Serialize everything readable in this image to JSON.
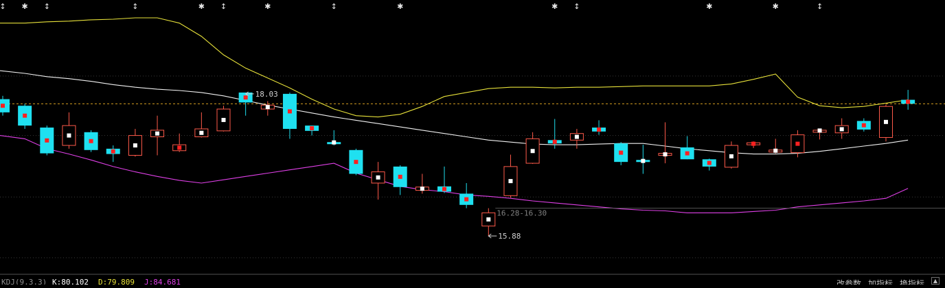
{
  "colors": {
    "background": "#000000",
    "grid": "#3a3a3a",
    "up_candle": "#ff5a4a",
    "down_candle": "#1fe0f0",
    "upper_band": "#e8e23a",
    "middle_band": "#f2f2f2",
    "lower_band": "#e040e8",
    "reference_line": "#d8a020",
    "annotation_text": "#d0d0d0",
    "marker_red": "#ff2020",
    "marker_white": "#ffffff",
    "event_marker": "#e8e8e8",
    "value_k": "#ffffff",
    "value_d": "#e8e23a",
    "value_j": "#e040e8",
    "menu_text": "#c0c0c0"
  },
  "chart_data": {
    "type": "candlestick",
    "ylim": [
      15.3,
      19.45
    ],
    "grid_values": [
      18.3,
      17.4,
      16.47,
      15.55
    ],
    "reference_price": 17.88,
    "event_markers": [
      {
        "index": 0,
        "symbol": "↕"
      },
      {
        "index": 1,
        "symbol": "✱"
      },
      {
        "index": 2,
        "symbol": "↕"
      },
      {
        "index": 6,
        "symbol": "↕"
      },
      {
        "index": 9,
        "symbol": "✱"
      },
      {
        "index": 10,
        "symbol": "↕"
      },
      {
        "index": 12,
        "symbol": "✱"
      },
      {
        "index": 15,
        "symbol": "↕"
      },
      {
        "index": 18,
        "symbol": "✱"
      },
      {
        "index": 25,
        "symbol": "✱"
      },
      {
        "index": 26,
        "symbol": "↕"
      },
      {
        "index": 32,
        "symbol": "✱"
      },
      {
        "index": 35,
        "symbol": "✱"
      },
      {
        "index": 37,
        "symbol": "↕"
      }
    ],
    "candles": [
      {
        "o": 17.75,
        "h": 18.0,
        "l": 17.7,
        "c": 17.95,
        "dir": "down",
        "mark": "red"
      },
      {
        "o": 17.85,
        "h": 17.88,
        "l": 17.5,
        "c": 17.55,
        "dir": "down",
        "mark": "red"
      },
      {
        "o": 17.52,
        "h": 17.55,
        "l": 17.1,
        "c": 17.13,
        "dir": "down",
        "mark": "red"
      },
      {
        "o": 17.25,
        "h": 17.75,
        "l": 17.2,
        "c": 17.55,
        "dir": "up",
        "mark": "white"
      },
      {
        "o": 17.45,
        "h": 17.48,
        "l": 17.15,
        "c": 17.18,
        "dir": "down",
        "mark": "red"
      },
      {
        "o": 17.2,
        "h": 17.25,
        "l": 17.0,
        "c": 17.12,
        "dir": "down",
        "mark": "red"
      },
      {
        "o": 17.1,
        "h": 17.5,
        "l": 17.08,
        "c": 17.4,
        "dir": "up",
        "mark": "white"
      },
      {
        "o": 17.38,
        "h": 17.7,
        "l": 17.1,
        "c": 17.48,
        "dir": "up",
        "mark": "white"
      },
      {
        "o": 17.17,
        "h": 17.43,
        "l": 17.15,
        "c": 17.26,
        "dir": "up",
        "mark": "red"
      },
      {
        "o": 17.38,
        "h": 17.75,
        "l": 17.37,
        "c": 17.5,
        "dir": "up",
        "mark": "white"
      },
      {
        "o": 17.47,
        "h": 17.85,
        "l": 17.46,
        "c": 17.8,
        "dir": "up",
        "mark": "white"
      },
      {
        "o": 17.9,
        "h": 18.03,
        "l": 17.7,
        "c": 18.05,
        "dir": "down",
        "mark": "red"
      },
      {
        "o": 17.8,
        "h": 17.92,
        "l": 17.7,
        "c": 17.86,
        "dir": "up",
        "mark": "white"
      },
      {
        "o": 17.5,
        "h": 18.05,
        "l": 17.35,
        "c": 18.03,
        "dir": "down",
        "mark": "red"
      },
      {
        "o": 17.47,
        "h": 17.55,
        "l": 17.4,
        "c": 17.55,
        "dir": "down",
        "mark": "red"
      },
      {
        "o": 17.29,
        "h": 17.48,
        "l": 17.25,
        "c": 17.3,
        "dir": "down",
        "mark": "white"
      },
      {
        "o": 17.18,
        "h": 17.2,
        "l": 16.8,
        "c": 16.82,
        "dir": "down",
        "mark": "red"
      },
      {
        "o": 16.85,
        "h": 17.0,
        "l": 16.43,
        "c": 16.68,
        "dir": "up",
        "mark": "white"
      },
      {
        "o": 16.62,
        "h": 16.95,
        "l": 16.5,
        "c": 16.93,
        "dir": "down",
        "mark": "red"
      },
      {
        "o": 16.57,
        "h": 16.82,
        "l": 16.52,
        "c": 16.62,
        "dir": "up",
        "mark": "white"
      },
      {
        "o": 16.55,
        "h": 16.93,
        "l": 16.53,
        "c": 16.63,
        "dir": "down",
        "mark": "red"
      },
      {
        "o": 16.35,
        "h": 16.68,
        "l": 16.3,
        "c": 16.52,
        "dir": "down",
        "mark": "red"
      },
      {
        "o": 16.23,
        "h": 16.3,
        "l": 15.88,
        "c": 16.03,
        "dir": "up",
        "mark": "white"
      },
      {
        "o": 16.49,
        "h": 17.11,
        "l": 16.46,
        "c": 16.93,
        "dir": "up",
        "mark": "white"
      },
      {
        "o": 16.98,
        "h": 17.45,
        "l": 16.97,
        "c": 17.35,
        "dir": "up",
        "mark": "white"
      },
      {
        "o": 17.28,
        "h": 17.65,
        "l": 17.2,
        "c": 17.33,
        "dir": "down",
        "mark": "red"
      },
      {
        "o": 17.33,
        "h": 17.5,
        "l": 17.2,
        "c": 17.43,
        "dir": "up",
        "mark": "white"
      },
      {
        "o": 17.46,
        "h": 17.63,
        "l": 17.41,
        "c": 17.52,
        "dir": "down",
        "mark": "red"
      },
      {
        "o": 17.0,
        "h": 17.3,
        "l": 16.95,
        "c": 17.28,
        "dir": "down",
        "mark": "red"
      },
      {
        "o": 17.0,
        "h": 17.26,
        "l": 16.82,
        "c": 17.03,
        "dir": "down",
        "mark": "white"
      },
      {
        "o": 17.1,
        "h": 17.6,
        "l": 16.98,
        "c": 17.13,
        "dir": "up",
        "mark": "white"
      },
      {
        "o": 17.04,
        "h": 17.39,
        "l": 17.04,
        "c": 17.22,
        "dir": "down",
        "mark": "red"
      },
      {
        "o": 16.93,
        "h": 17.05,
        "l": 16.87,
        "c": 17.04,
        "dir": "down",
        "mark": "red"
      },
      {
        "o": 16.92,
        "h": 17.31,
        "l": 16.9,
        "c": 17.25,
        "dir": "up",
        "mark": "white"
      },
      {
        "o": 17.26,
        "h": 17.31,
        "l": 17.21,
        "c": 17.29,
        "dir": "up",
        "mark": "red"
      },
      {
        "o": 17.16,
        "h": 17.35,
        "l": 17.13,
        "c": 17.18,
        "dir": "up",
        "mark": "white"
      },
      {
        "o": 17.14,
        "h": 17.48,
        "l": 17.07,
        "c": 17.41,
        "dir": "up",
        "mark": "red"
      },
      {
        "o": 17.47,
        "h": 17.5,
        "l": 17.34,
        "c": 17.48,
        "dir": "up",
        "mark": "white"
      },
      {
        "o": 17.44,
        "h": 17.66,
        "l": 17.35,
        "c": 17.55,
        "dir": "up",
        "mark": "white"
      },
      {
        "o": 17.49,
        "h": 17.66,
        "l": 17.46,
        "c": 17.62,
        "dir": "down",
        "mark": "red"
      },
      {
        "o": 17.37,
        "h": 17.87,
        "l": 17.31,
        "c": 17.84,
        "dir": "up",
        "mark": "white"
      },
      {
        "o": 17.88,
        "h": 18.09,
        "l": 17.79,
        "c": 17.94,
        "dir": "down",
        "mark": "red"
      }
    ],
    "series": [
      {
        "key": "upper",
        "values": [
          19.1,
          19.1,
          19.12,
          19.13,
          19.15,
          19.16,
          19.18,
          19.18,
          19.1,
          18.9,
          18.62,
          18.42,
          18.27,
          18.12,
          17.95,
          17.8,
          17.7,
          17.68,
          17.72,
          17.84,
          17.99,
          18.05,
          18.11,
          18.13,
          18.13,
          18.12,
          18.13,
          18.13,
          18.14,
          18.15,
          18.15,
          18.15,
          18.15,
          18.18,
          18.25,
          18.33,
          17.98,
          17.85,
          17.82,
          17.84,
          17.89,
          17.94
        ]
      },
      {
        "key": "middle",
        "values": [
          18.38,
          18.34,
          18.29,
          18.26,
          18.22,
          18.17,
          18.13,
          18.1,
          18.08,
          18.05,
          18.0,
          17.93,
          17.86,
          17.8,
          17.74,
          17.68,
          17.63,
          17.58,
          17.53,
          17.48,
          17.43,
          17.38,
          17.33,
          17.3,
          17.27,
          17.26,
          17.26,
          17.27,
          17.28,
          17.28,
          17.24,
          17.2,
          17.17,
          17.14,
          17.12,
          17.12,
          17.13,
          17.16,
          17.2,
          17.24,
          17.28,
          17.33
        ]
      },
      {
        "key": "lower",
        "values": [
          17.4,
          17.35,
          17.2,
          17.12,
          17.03,
          16.93,
          16.85,
          16.78,
          16.72,
          16.68,
          16.73,
          16.78,
          16.83,
          16.88,
          16.93,
          16.98,
          16.83,
          16.73,
          16.63,
          16.58,
          16.55,
          16.5,
          16.48,
          16.45,
          16.41,
          16.38,
          16.35,
          16.32,
          16.29,
          16.27,
          16.26,
          16.23,
          16.23,
          16.23,
          16.25,
          16.27,
          16.32,
          16.35,
          16.38,
          16.41,
          16.45,
          16.6
        ]
      }
    ],
    "annotations": {
      "high_label": "18.03",
      "low_label": "15.88",
      "range_label": "16.28-16.30"
    },
    "range_label_price": 16.3
  },
  "bottom_bar": {
    "indicator_name": "KDJ(9,3,3)",
    "k_label": "K:80.102",
    "d_label": "D:79.809",
    "j_label": "J:84.681",
    "menu_items": [
      "改参数",
      "加指标",
      "换指标"
    ],
    "scroll_up_icon": "chevron-up-icon"
  }
}
